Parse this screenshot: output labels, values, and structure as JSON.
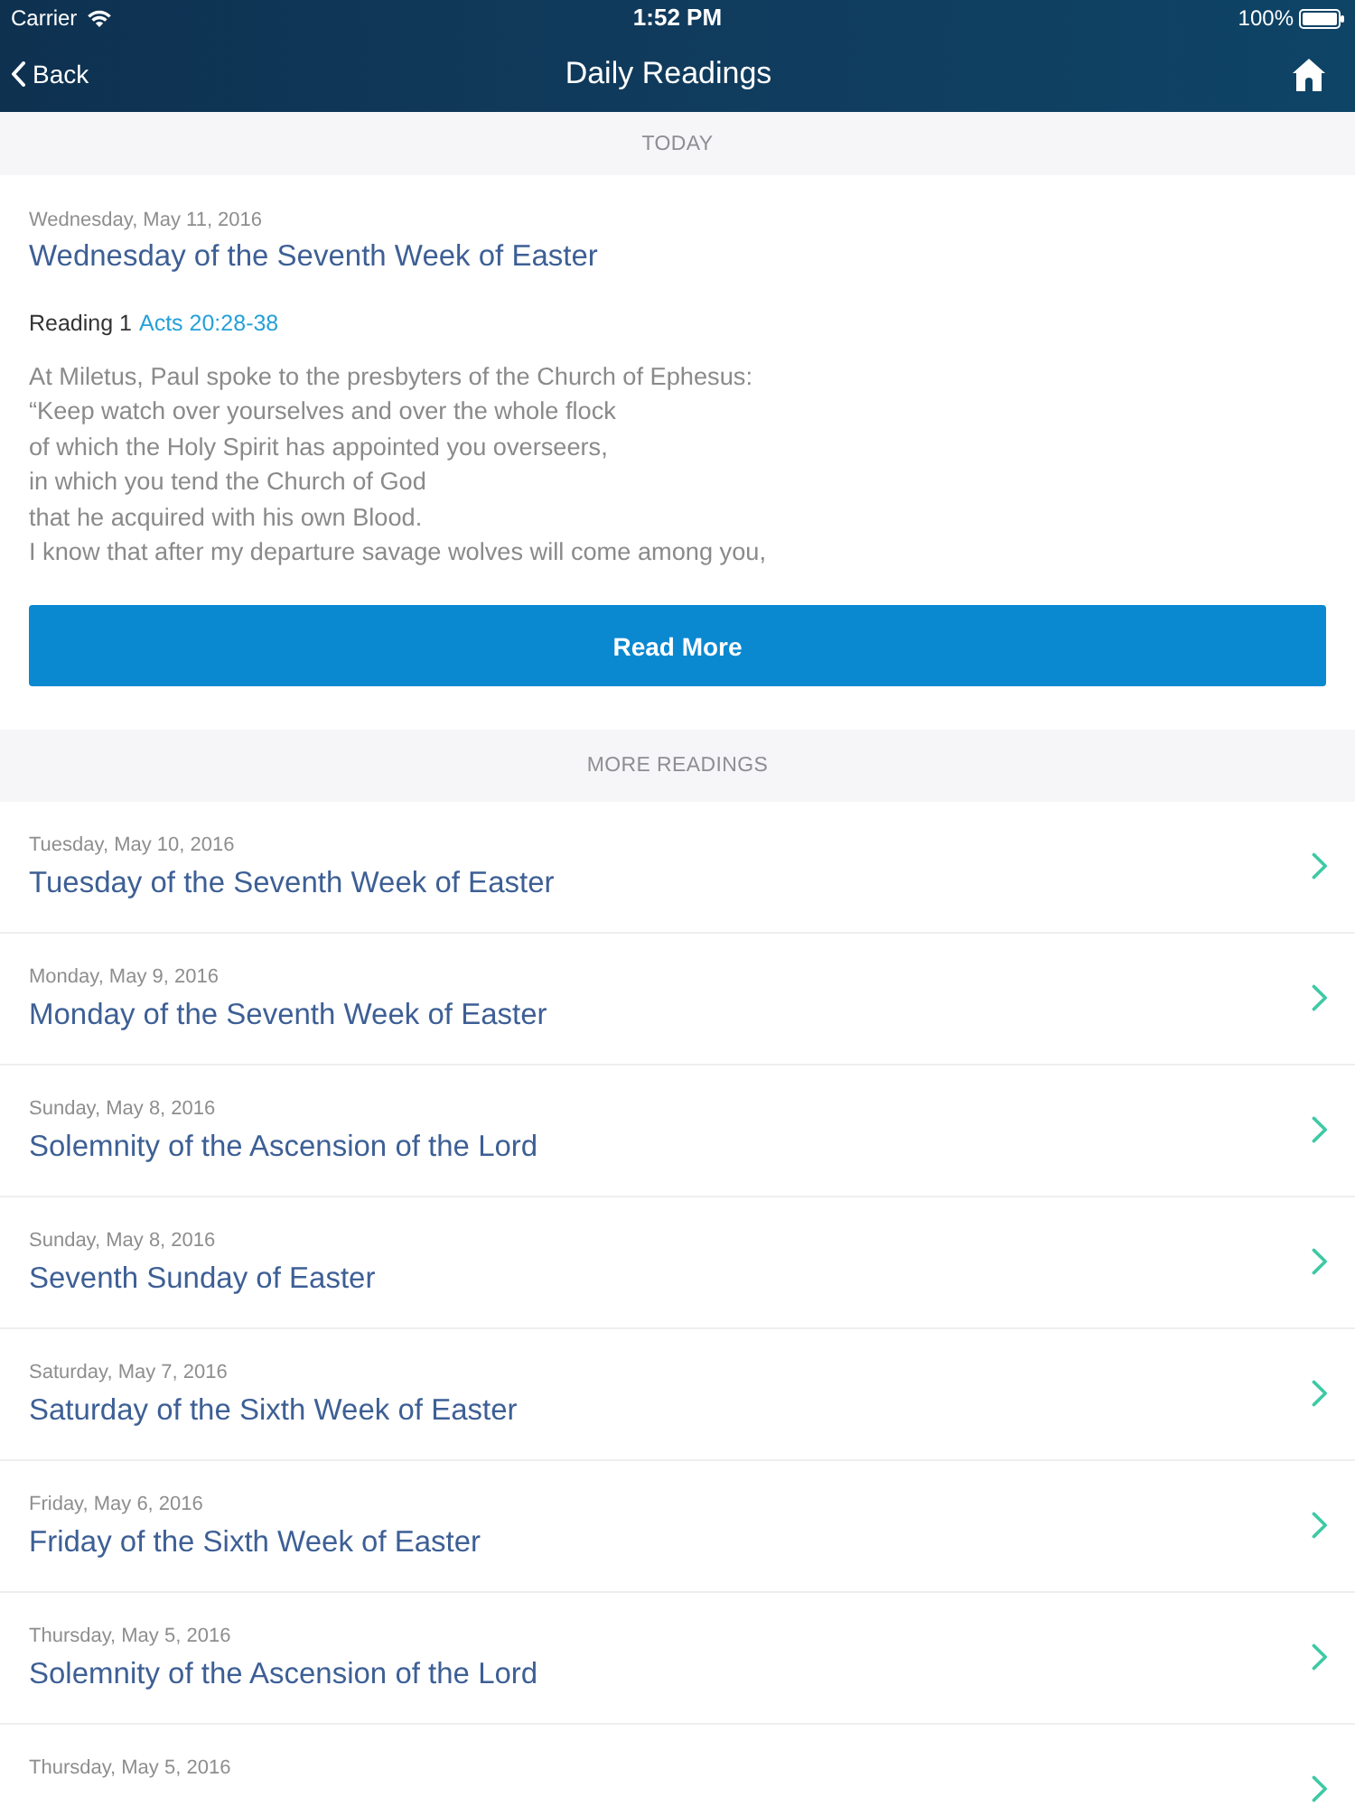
{
  "status_bar": {
    "carrier": "Carrier",
    "time": "1:52 PM",
    "battery": "100%"
  },
  "nav_bar": {
    "back": "Back",
    "title": "Daily Readings"
  },
  "today": {
    "header": "TODAY",
    "date": "Wednesday, May 11, 2016",
    "title": "Wednesday of the Seventh Week of Easter",
    "reading_label": "Reading 1",
    "reading_reference": "Acts 20:28-38",
    "text_lines": [
      "At Miletus, Paul spoke to the presbyters of the Church of Ephesus:",
      "“Keep watch over yourselves and over the whole flock",
      "of which the Holy Spirit has appointed you overseers,",
      "in which you tend the Church of God",
      "that he acquired with his own Blood.",
      "I know that after my departure savage wolves will come among you,"
    ],
    "button": "Read More"
  },
  "more_readings": {
    "header": "MORE READINGS",
    "items": [
      {
        "date": "Tuesday, May 10, 2016",
        "title": "Tuesday of the Seventh Week of Easter"
      },
      {
        "date": "Monday, May 9, 2016",
        "title": "Monday of the Seventh Week of Easter"
      },
      {
        "date": "Sunday, May 8, 2016",
        "title": "Solemnity of the Ascension of the Lord"
      },
      {
        "date": "Sunday, May 8, 2016",
        "title": "Seventh Sunday of Easter"
      },
      {
        "date": "Saturday, May 7, 2016",
        "title": "Saturday of the Sixth Week of Easter"
      },
      {
        "date": "Friday, May 6, 2016",
        "title": "Friday of the Sixth Week of Easter"
      },
      {
        "date": "Thursday, May 5, 2016",
        "title": "Solemnity of the Ascension of the Lord"
      },
      {
        "date": "Thursday, May 5, 2016"
      }
    ]
  }
}
